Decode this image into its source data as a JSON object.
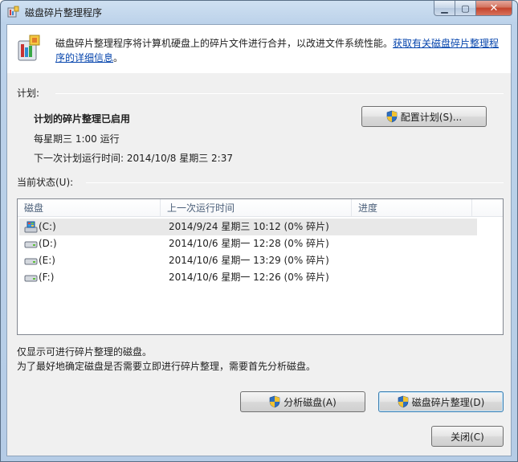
{
  "window": {
    "title": "磁盘碎片整理程序",
    "caption_min": "▁",
    "caption_max": "▢",
    "caption_close": "✕"
  },
  "header": {
    "description": "磁盘碎片整理程序将计算机硬盘上的碎片文件进行合并，以改进文件系统性能。",
    "link": "获取有关磁盘碎片整理程序的详细信息",
    "link_suffix": "。"
  },
  "schedule": {
    "section_label": "计划:",
    "status": "计划的碎片整理已启用",
    "frequency": "每星期三  1:00 运行",
    "next_run_label": "下一次计划运行时间:",
    "next_run_value": "2014/10/8 星期三  2:37",
    "configure_button": "配置计划(S)..."
  },
  "current_status": {
    "section_label": "当前状态(U):",
    "columns": [
      "磁盘",
      "上一次运行时间",
      "进度"
    ],
    "rows": [
      {
        "disk": "(C:)",
        "last_run": "2014/9/24 星期三  10:12 (0% 碎片)",
        "progress": "",
        "icon": "system-drive-icon"
      },
      {
        "disk": "(D:)",
        "last_run": "2014/10/6 星期一  12:28 (0% 碎片)",
        "progress": "",
        "icon": "drive-icon"
      },
      {
        "disk": "(E:)",
        "last_run": "2014/10/6 星期一  13:29 (0% 碎片)",
        "progress": "",
        "icon": "drive-icon"
      },
      {
        "disk": "(F:)",
        "last_run": "2014/10/6 星期一  12:26 (0% 碎片)",
        "progress": "",
        "icon": "drive-icon"
      }
    ]
  },
  "footer": {
    "note1": "仅显示可进行碎片整理的磁盘。",
    "note2": "为了最好地确定磁盘是否需要立即进行碎片整理，需要首先分析磁盘。",
    "analyze_button": "分析磁盘(A)",
    "defrag_button": "磁盘碎片整理(D)",
    "close_button": "关闭(C)"
  },
  "colors": {
    "link": "#0645ad",
    "title_bar": "#bcd2ea",
    "selected_row": "#e8e8e8"
  }
}
